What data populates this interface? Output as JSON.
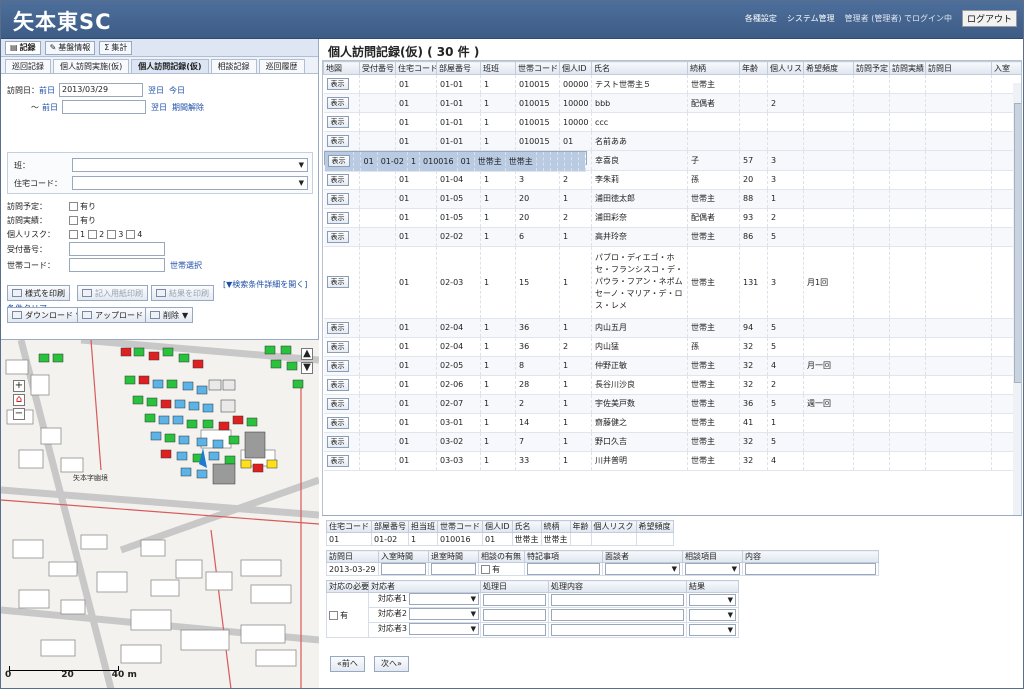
{
  "app": {
    "title": "矢本東SC"
  },
  "header_nav": {
    "settings": "各種設定",
    "system": "システム管理",
    "user_text": "管理者 (管理者) でログイン中",
    "logout": "ログアウト"
  },
  "tool_tabs": [
    {
      "label": "記録",
      "icon": "book-icon"
    },
    {
      "label": "基盤情報",
      "icon": "pencil-icon"
    },
    {
      "label": "集計",
      "icon": "sigma-icon"
    }
  ],
  "sub_tabs": [
    "巡回記録",
    "個人訪問実施(仮)",
    "個人訪問記録(仮)",
    "相談記録",
    "巡回履歴"
  ],
  "form": {
    "visit_date_label": "訪問日：",
    "from_label": "前日",
    "from_value": "2013/03/29",
    "next_label": "翌日",
    "today_label": "今日",
    "to_prefix": "～",
    "to_label": "前日",
    "to_next": "翌日",
    "clear_period": "期間解除",
    "group_label": "班：",
    "house_label": "住宅コード：",
    "planned_label": "訪問予定：",
    "planned_opt": "有り",
    "done_label": "訪問実績：",
    "done_opt": "有り",
    "risk_label": "個人リスク：",
    "risk_opts": [
      "1",
      "2",
      "3",
      "4"
    ],
    "receipt_label": "受付番号：",
    "household_label": "世帯コード：",
    "household_select": "世帯選択",
    "detail_toggle": "[▼検索条件詳細を開く]",
    "clear_conditions": "条件クリア"
  },
  "actions": {
    "print_form": "様式を印刷",
    "print_blank": "記入用紙印刷",
    "print_result": "結果を印刷",
    "download": "ダウンロード",
    "upload": "アップロード",
    "delete": "削除"
  },
  "map": {
    "label_block": "矢本字幽境",
    "scale_labels": [
      "0",
      "20",
      "40 m"
    ]
  },
  "records": {
    "title": "個人訪問記録(仮) ( 30 件 )",
    "show_label": "表示",
    "columns": [
      "地図",
      "受付番号",
      "住宅コード",
      "部屋番号",
      "班班",
      "世帯コード",
      "個人ID",
      "氏名",
      "続柄",
      "年齢",
      "個人リスク",
      "希望頻度",
      "訪問予定",
      "訪問実績",
      "訪問日",
      "入室"
    ],
    "rows": [
      {
        "house": "01",
        "room": "01-01",
        "team": "1",
        "household": "010015",
        "pid": "00000",
        "name": "テスト世帯主５",
        "relation": "世帯主",
        "age": "",
        "risk": "",
        "freq": ""
      },
      {
        "house": "01",
        "room": "01-01",
        "team": "1",
        "household": "010015",
        "pid": "10000",
        "name": "bbb",
        "relation": "配偶者",
        "age": "",
        "risk": "2",
        "freq": ""
      },
      {
        "house": "01",
        "room": "01-01",
        "team": "1",
        "household": "010015",
        "pid": "10000",
        "name": "ccc",
        "relation": "",
        "age": "",
        "risk": "",
        "freq": ""
      },
      {
        "house": "01",
        "room": "01-01",
        "team": "1",
        "household": "010015",
        "pid": "01",
        "name": "名前ああ",
        "relation": "",
        "age": "",
        "risk": "",
        "freq": ""
      },
      {
        "house": "01",
        "room": "01-02",
        "team": "1",
        "household": "010016",
        "pid": "01",
        "name": "世帯主",
        "relation": "世帯主",
        "age": "",
        "risk": "",
        "freq": ""
      },
      {
        "house": "01",
        "room": "01-04",
        "team": "1",
        "household": "3",
        "pid": "3",
        "name": "幸喜良",
        "relation": "子",
        "age": "57",
        "risk": "3",
        "freq": ""
      },
      {
        "house": "01",
        "room": "01-04",
        "team": "1",
        "household": "3",
        "pid": "2",
        "name": "李朱莉",
        "relation": "孫",
        "age": "20",
        "risk": "3",
        "freq": ""
      },
      {
        "house": "01",
        "room": "01-05",
        "team": "1",
        "household": "20",
        "pid": "1",
        "name": "浦田徳太郎",
        "relation": "世帯主",
        "age": "88",
        "risk": "1",
        "freq": ""
      },
      {
        "house": "01",
        "room": "01-05",
        "team": "1",
        "household": "20",
        "pid": "2",
        "name": "浦田彩奈",
        "relation": "配偶者",
        "age": "93",
        "risk": "2",
        "freq": ""
      },
      {
        "house": "01",
        "room": "02-02",
        "team": "1",
        "household": "6",
        "pid": "1",
        "name": "高井玲奈",
        "relation": "世帯主",
        "age": "86",
        "risk": "5",
        "freq": ""
      },
      {
        "house": "01",
        "room": "02-03",
        "team": "1",
        "household": "15",
        "pid": "1",
        "name": "パブロ・ディエゴ・ホセ・フランシスコ・デ・パウラ・フアン・ネポムセーノ・マリア・デ・ロス・レメ",
        "relation": "世帯主",
        "age": "131",
        "risk": "3",
        "freq": "月1回",
        "tall": true
      },
      {
        "house": "01",
        "room": "02-04",
        "team": "1",
        "household": "36",
        "pid": "1",
        "name": "内山五月",
        "relation": "世帯主",
        "age": "94",
        "risk": "5",
        "freq": ""
      },
      {
        "house": "01",
        "room": "02-04",
        "team": "1",
        "household": "36",
        "pid": "2",
        "name": "内山猛",
        "relation": "孫",
        "age": "32",
        "risk": "5",
        "freq": ""
      },
      {
        "house": "01",
        "room": "02-05",
        "team": "1",
        "household": "8",
        "pid": "1",
        "name": "仲野正敏",
        "relation": "世帯主",
        "age": "32",
        "risk": "4",
        "freq": "月一回"
      },
      {
        "house": "01",
        "room": "02-06",
        "team": "1",
        "household": "28",
        "pid": "1",
        "name": "長谷川沙良",
        "relation": "世帯主",
        "age": "32",
        "risk": "2",
        "freq": ""
      },
      {
        "house": "01",
        "room": "02-07",
        "team": "1",
        "household": "2",
        "pid": "1",
        "name": "宇佐美戸数",
        "relation": "世帯主",
        "age": "36",
        "risk": "5",
        "freq": "週一回"
      },
      {
        "house": "01",
        "room": "03-01",
        "team": "1",
        "household": "14",
        "pid": "1",
        "name": "齋藤健之",
        "relation": "世帯主",
        "age": "41",
        "risk": "1",
        "freq": ""
      },
      {
        "house": "01",
        "room": "03-02",
        "team": "1",
        "household": "7",
        "pid": "1",
        "name": "野口久吉",
        "relation": "世帯主",
        "age": "32",
        "risk": "5",
        "freq": ""
      },
      {
        "house": "01",
        "room": "03-03",
        "team": "1",
        "household": "33",
        "pid": "1",
        "name": "川井普明",
        "relation": "世帯主",
        "age": "32",
        "risk": "4",
        "freq": ""
      }
    ]
  },
  "detail": {
    "summary_headers": [
      "住宅コード",
      "部屋番号",
      "担当班",
      "世帯コード",
      "個人ID",
      "氏名",
      "続柄",
      "年齢",
      "個人リスク",
      "希望頻度"
    ],
    "summary_values": [
      "01",
      "01-02",
      "1",
      "010016",
      "01",
      "世帯主",
      "世帯主",
      "",
      "",
      ""
    ],
    "visit_headers": [
      "訪問日",
      "入室時間",
      "退室時間",
      "相談の有無",
      "特記事項",
      "面談者",
      "相談項目",
      "内容"
    ],
    "visit_date": "2013-03-29",
    "consult_opt": "有",
    "response_headers": [
      "対応の必要",
      "対応者",
      "処理日",
      "処理内容",
      "結果"
    ],
    "need_opt": "有",
    "responders": [
      "対応者1",
      "対応者2",
      "対応者3"
    ],
    "prev": "«前へ",
    "next": "次へ»"
  }
}
